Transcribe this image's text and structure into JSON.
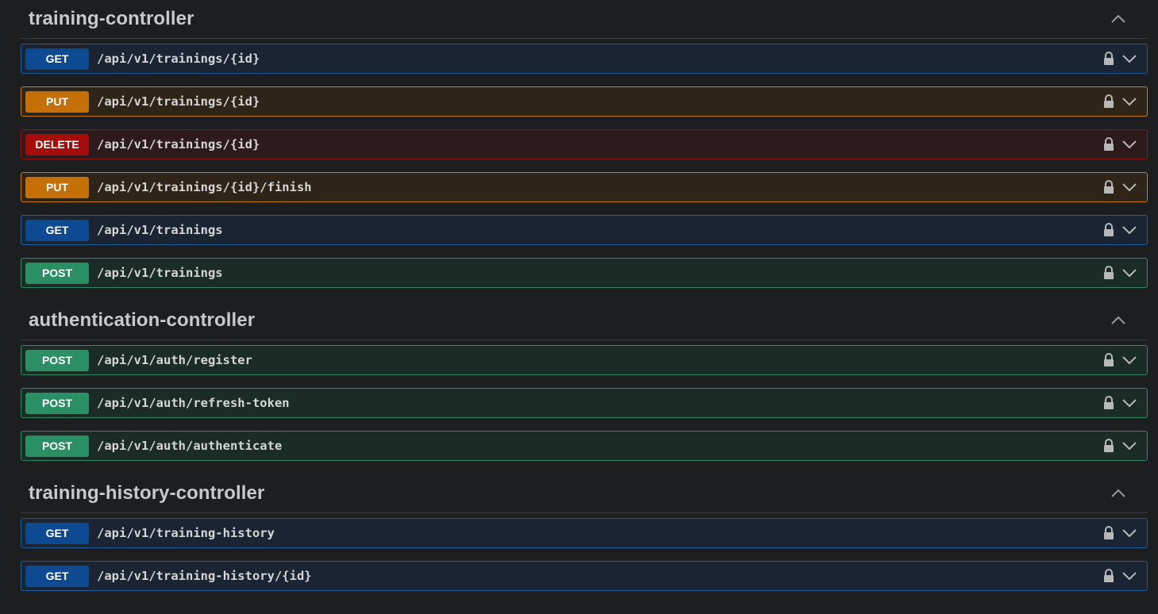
{
  "sections": [
    {
      "title": "training-controller",
      "operations": [
        {
          "method": "GET",
          "path": "/api/v1/trainings/{id}"
        },
        {
          "method": "PUT",
          "path": "/api/v1/trainings/{id}"
        },
        {
          "method": "DELETE",
          "path": "/api/v1/trainings/{id}"
        },
        {
          "method": "PUT",
          "path": "/api/v1/trainings/{id}/finish"
        },
        {
          "method": "GET",
          "path": "/api/v1/trainings"
        },
        {
          "method": "POST",
          "path": "/api/v1/trainings"
        }
      ]
    },
    {
      "title": "authentication-controller",
      "operations": [
        {
          "method": "POST",
          "path": "/api/v1/auth/register"
        },
        {
          "method": "POST",
          "path": "/api/v1/auth/refresh-token"
        },
        {
          "method": "POST",
          "path": "/api/v1/auth/authenticate"
        }
      ]
    },
    {
      "title": "training-history-controller",
      "operations": [
        {
          "method": "GET",
          "path": "/api/v1/training-history"
        },
        {
          "method": "GET",
          "path": "/api/v1/training-history/{id}"
        }
      ]
    }
  ],
  "icons": {
    "collapse": "chevron-up-icon",
    "lock": "lock-icon",
    "expand": "chevron-down-icon"
  },
  "colors": {
    "get": "#0e4a91",
    "put": "#c46f08",
    "delete": "#a50c0c",
    "post": "#2b8f66"
  }
}
